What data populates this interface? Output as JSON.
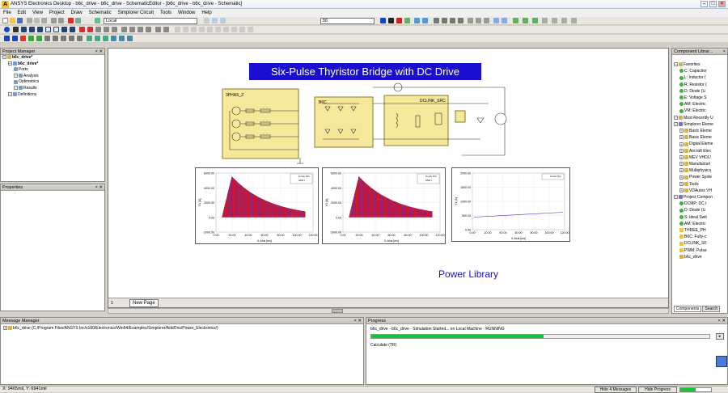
{
  "window": {
    "title": "ANSYS Electronics Desktop - b6c_drive - b6c_drive - SchematicEditor - [b6c_drive - b6c_drive - Schematic]"
  },
  "menu": [
    "File",
    "Edit",
    "View",
    "Project",
    "Draw",
    "Schematic",
    "Simplorer Circuit",
    "Tools",
    "Window",
    "Help"
  ],
  "toolbar": {
    "location_value": "Local",
    "zoom_value": "56"
  },
  "project_manager": {
    "title": "Project Manager",
    "tree": [
      {
        "label": "b6c_drive*",
        "level": 0,
        "bold": true
      },
      {
        "label": "b6c_drive*",
        "level": 1,
        "bold": true
      },
      {
        "label": "Ports",
        "level": 2,
        "bold": false
      },
      {
        "label": "Analysis",
        "level": 2,
        "bold": false
      },
      {
        "label": "Optimetrics",
        "level": 2,
        "bold": false
      },
      {
        "label": "Results",
        "level": 2,
        "bold": false
      },
      {
        "label": "Definitions",
        "level": 1,
        "bold": false
      }
    ]
  },
  "properties": {
    "title": "Properties"
  },
  "schematic": {
    "title": "Six-Pulse Thyristor Bridge with DC Drive",
    "footer_label": "Power Library",
    "blocks": {
      "source": "3PHAS_Z",
      "bridge": "B6C",
      "controller": "DCLINK_SRC"
    },
    "tabs": {
      "page_number": "1",
      "new_page": "New Page"
    }
  },
  "plots": [
    {
      "legend": [
        "Curve Info",
        "AM1.I"
      ],
      "xlabel": "X-Axis [ms]",
      "ylabel": "Y1 [A]",
      "yticks": [
        "6000.00",
        "4000.00",
        "2000.00",
        "0.00",
        "-2000.00"
      ],
      "xticks": [
        "0.00",
        "20.00",
        "40.00",
        "60.00",
        "80.00",
        "100.00",
        "120.00"
      ]
    },
    {
      "legend": [
        "Curve Info",
        "AM2.I"
      ],
      "xlabel": "X-Axis [ms]",
      "ylabel": "Y1 [A]",
      "yticks": [
        "6000.00",
        "4000.00",
        "2000.00",
        "0.00",
        "-2000.00"
      ],
      "xticks": [
        "0.00",
        "20.00",
        "40.00",
        "60.00",
        "80.00",
        "100.00",
        "120.00"
      ]
    },
    {
      "legend": [
        "Curve Info"
      ],
      "xlabel": "X-Axis [ms]",
      "ylabel": "Y1 [A]",
      "yticks": [
        "2000.00",
        "1500.00",
        "1000.00",
        "500.00",
        "0.00"
      ],
      "xticks": [
        "0.00",
        "20.00",
        "40.00",
        "60.00",
        "80.00",
        "100.00",
        "120.00"
      ]
    }
  ],
  "component_library": {
    "title": "Component Librar...",
    "items": [
      {
        "label": "Favorites",
        "level": 0,
        "icon": "#d9b04c"
      },
      {
        "label": "C: Capacitor",
        "level": 1,
        "icon": "#3cb43c"
      },
      {
        "label": "L: Inductor (",
        "level": 1,
        "icon": "#3cb43c"
      },
      {
        "label": "R: Resistor (",
        "level": 1,
        "icon": "#3cb43c"
      },
      {
        "label": "D: Diode (Li",
        "level": 1,
        "icon": "#3cb43c"
      },
      {
        "label": "E: Voltage S",
        "level": 1,
        "icon": "#3cb43c"
      },
      {
        "label": "AM: Electric",
        "level": 1,
        "icon": "#3cb43c"
      },
      {
        "label": "VM: Electric",
        "level": 1,
        "icon": "#3cb43c"
      },
      {
        "label": "Most Recently U",
        "level": 0,
        "icon": "#d9b04c"
      },
      {
        "label": "Simplorer Eleme",
        "level": 0,
        "icon": "#7a6cd0"
      },
      {
        "label": "Basic Eleme",
        "level": 1,
        "icon": "#d9b04c"
      },
      {
        "label": "Basic Eleme",
        "level": 1,
        "icon": "#d9b04c"
      },
      {
        "label": "Digital Eleme",
        "level": 1,
        "icon": "#d9b04c"
      },
      {
        "label": "Aircraft Elec",
        "level": 1,
        "icon": "#d9b04c"
      },
      {
        "label": "MEV VHDL/",
        "level": 1,
        "icon": "#d9b04c"
      },
      {
        "label": "Manufacturi",
        "level": 1,
        "icon": "#d9b04c"
      },
      {
        "label": "Multiphysics",
        "level": 1,
        "icon": "#d9b04c"
      },
      {
        "label": "Power Syste",
        "level": 1,
        "icon": "#d9b04c"
      },
      {
        "label": "Tools",
        "level": 1,
        "icon": "#d9b04c"
      },
      {
        "label": "VDAutos VH",
        "level": 1,
        "icon": "#d9b04c"
      },
      {
        "label": "Project Compon",
        "level": 0,
        "icon": "#7a6cd0"
      },
      {
        "label": "DCMP: DC I",
        "level": 1,
        "icon": "#3cb43c"
      },
      {
        "label": "D: Diode (Li",
        "level": 1,
        "icon": "#3cb43c"
      },
      {
        "label": "S: Ideal Swit",
        "level": 1,
        "icon": "#3cb43c"
      },
      {
        "label": "AM: Electric",
        "level": 1,
        "icon": "#3cb43c"
      },
      {
        "label": "THREE_PH",
        "level": 1,
        "icon": "#e6c640"
      },
      {
        "label": "B6C: Fully-c",
        "level": 1,
        "icon": "#e6c640"
      },
      {
        "label": "DCLINK_SF",
        "level": 1,
        "icon": "#e6c640"
      },
      {
        "label": "PWM: Pulse",
        "level": 1,
        "icon": "#e6c640"
      },
      {
        "label": "b6c_drive",
        "level": 1,
        "icon": "#d9b04c"
      }
    ],
    "tabs": [
      "Components",
      "Search"
    ]
  },
  "message_manager": {
    "title": "Message Manager",
    "entry": "b6c_drive (C:/Program Files/ANSYS Inc/v180/Electronics/Win64/Examples/Simplorer/AddOns/Power_Electronics/)"
  },
  "progress": {
    "title": "Progress",
    "status": "b6c_drive - b6c_drive - Simulation Started... on Local Machine - RUNNING",
    "fraction": 0.51,
    "task": "Calculate (TR)"
  },
  "statusbar": {
    "coords": "X: 9465mil, Y: 6941mil",
    "hide_messages": "Hide 4 Messages",
    "hide_progress": "Hide Progress"
  },
  "colors": {
    "waveform_fill": "#c8001a",
    "waveform_lines": "#3a2fe0",
    "title_bg": "#1a0fd0",
    "progress": "#10c830",
    "footer_text": "#1a0fd0"
  }
}
